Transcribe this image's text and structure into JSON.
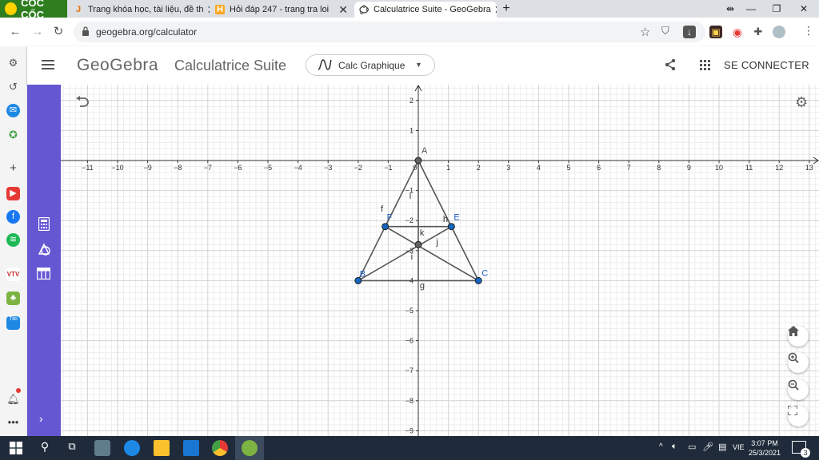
{
  "browser": {
    "brand": "CỐC CỐC",
    "tabs": [
      {
        "title": "Trang khóa học, tài liệu, đề th",
        "favicon": "J",
        "active": false
      },
      {
        "title": "Hỏi đáp 247 - trang tra loi",
        "favicon": "H",
        "active": false
      },
      {
        "title": "Calculatrice Suite - GeoGebra",
        "favicon": "geogebra-icon",
        "active": true
      }
    ],
    "url": "geogebra.org/calculator"
  },
  "geogebra": {
    "logo": "GeoGebra",
    "suite_title": "Calculatrice Suite",
    "app_selector": "Calc Graphique",
    "sign_in": "SE CONNECTER",
    "colors": {
      "toolbar": "#6557d2",
      "point_blue": "#1565c0",
      "point_gray": "#616161",
      "segment": "#555555"
    }
  },
  "graph": {
    "x_ticks": [
      "−11",
      "−10",
      "−9",
      "−8",
      "−7",
      "−6",
      "−5",
      "−4",
      "−3",
      "−2",
      "−1",
      "0",
      "1",
      "2",
      "3",
      "4",
      "5",
      "6",
      "7",
      "8",
      "9",
      "10",
      "11",
      "12",
      "13"
    ],
    "y_ticks": [
      "2",
      "1",
      "−1",
      "−2",
      "−3",
      "−4",
      "−5",
      "−6",
      "−7",
      "−8",
      "−9"
    ],
    "points": [
      {
        "name": "A",
        "x": 0,
        "y": 0,
        "color": "gray"
      },
      {
        "name": "B",
        "x": -2,
        "y": -4,
        "color": "blue"
      },
      {
        "name": "C",
        "x": 2,
        "y": -4,
        "color": "blue"
      },
      {
        "name": "E",
        "x": 1.1,
        "y": -2.2,
        "color": "blue"
      },
      {
        "name": "F",
        "x": -1.1,
        "y": -2.2,
        "color": "blue"
      },
      {
        "name": "",
        "x": 0,
        "y": -2.8,
        "color": "gray"
      }
    ],
    "segment_labels": [
      "f",
      "h",
      "l",
      "k",
      "i",
      "j",
      "g"
    ]
  },
  "taskbar": {
    "time": "3:07 PM",
    "date": "25/3/2021",
    "language": "VIE",
    "notification_count": "3"
  }
}
